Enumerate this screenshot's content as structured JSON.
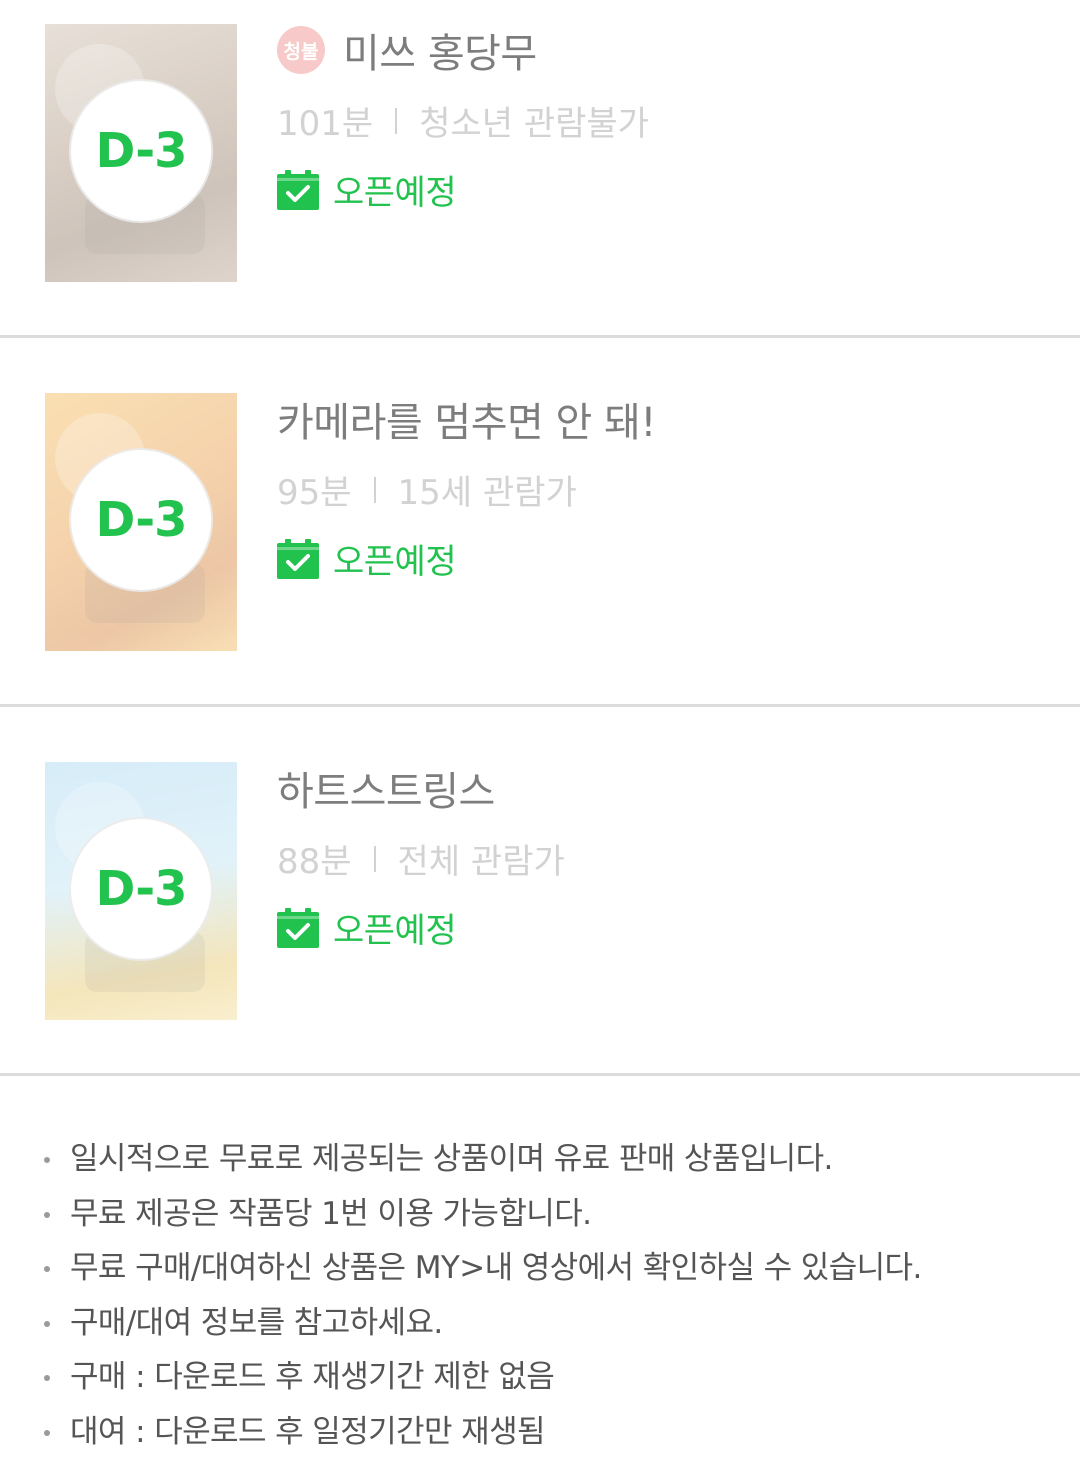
{
  "movies": [
    {
      "title": "미쓰 홍당무",
      "rating_badge": "청불",
      "runtime": "101분",
      "age_rating": "청소년 관람불가",
      "dday": "D-3",
      "status": "오픈예정",
      "poster_icon": "poster-image"
    },
    {
      "title": "카메라를 멈추면 안 돼!",
      "rating_badge": "",
      "runtime": "95분",
      "age_rating": "15세 관람가",
      "dday": "D-3",
      "status": "오픈예정",
      "poster_icon": "poster-image"
    },
    {
      "title": "하트스트링스",
      "rating_badge": "",
      "runtime": "88분",
      "age_rating": "전체 관람가",
      "dday": "D-3",
      "status": "오픈예정",
      "poster_icon": "poster-image"
    }
  ],
  "notes": [
    "일시적으로 무료로 제공되는 상품이며 유료 판매 상품입니다.",
    "무료 제공은 작품당 1번 이용 가능합니다.",
    "무료 구매/대여하신 상품은 MY>내 영상에서 확인하실 수 있습니다.",
    "구매/대여 정보를 참고하세요.",
    "구매 : 다운로드 후 재생기간 제한 없음",
    "대여 : 다운로드 후 일정기간만 재생됨"
  ],
  "colors": {
    "accent_green": "#21c24e",
    "rating_badge_pink": "#f7c9c9",
    "divider": "#dcdcdc"
  },
  "icons": {
    "status_icon": "calendar-check-icon",
    "note_bullet": "bullet-dot-icon"
  }
}
